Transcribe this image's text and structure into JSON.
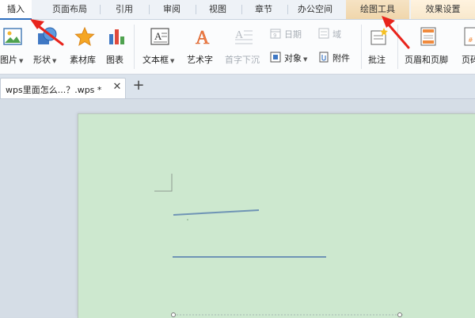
{
  "menu": {
    "tabs": [
      {
        "id": "insert",
        "label": "插入",
        "state": "active"
      },
      {
        "id": "page-layout",
        "label": "页面布局",
        "state": "normal"
      },
      {
        "id": "references",
        "label": "引用",
        "state": "normal"
      },
      {
        "id": "review",
        "label": "审阅",
        "state": "normal"
      },
      {
        "id": "view",
        "label": "视图",
        "state": "normal"
      },
      {
        "id": "chapter",
        "label": "章节",
        "state": "normal"
      },
      {
        "id": "office-space",
        "label": "办公空间",
        "state": "normal"
      },
      {
        "id": "drawing-tools",
        "label": "绘图工具",
        "state": "context"
      },
      {
        "id": "effects",
        "label": "效果设置",
        "state": "context-light"
      }
    ]
  },
  "ribbon": {
    "picture": "图片",
    "shapes": "形状",
    "material": "素材库",
    "chart": "图表",
    "textbox": "文本框",
    "wordart": "艺术字",
    "dropcap": "首字下沉",
    "date": "日期",
    "field": "域",
    "object": "对象",
    "attachment": "附件",
    "comment": "批注",
    "header_footer": "页眉和页脚",
    "page_number": "页码"
  },
  "doc_tabs": {
    "title": "wps里面怎么...？.wps *",
    "close": "✕",
    "new": "+"
  },
  "colors": {
    "page_bg": "#cde8cf",
    "annotation_arrow": "#e8241c",
    "line_shape": "#6f94b5"
  },
  "icons": [
    "picture-icon",
    "shapes-icon",
    "star-icon",
    "chart-icon",
    "textbox-icon",
    "wordart-icon",
    "dropcap-icon",
    "date-icon",
    "field-icon",
    "object-icon",
    "attachment-icon",
    "comment-icon",
    "header-footer-icon",
    "page-number-icon"
  ]
}
